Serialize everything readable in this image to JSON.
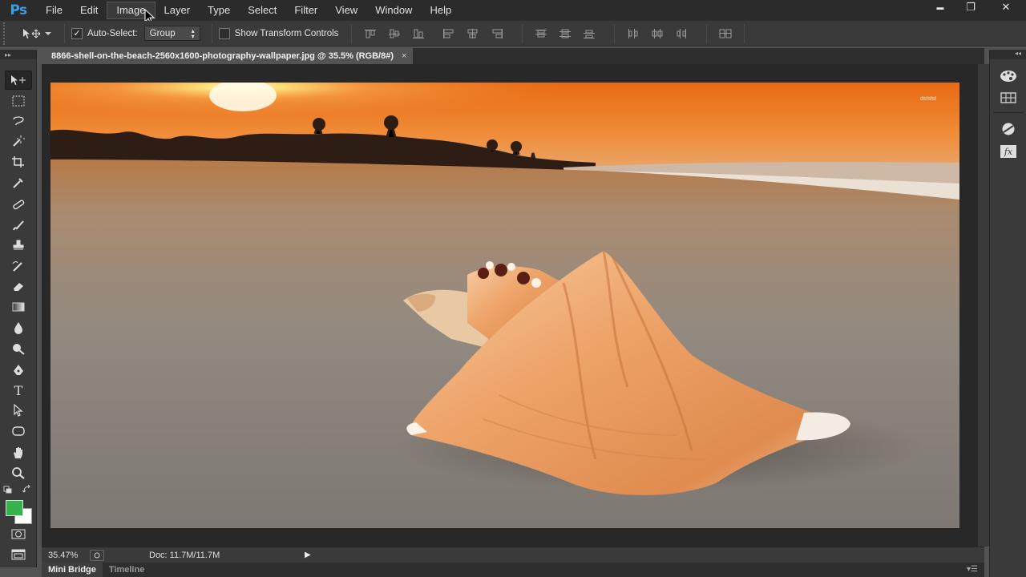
{
  "app": {
    "logo": "Ps"
  },
  "menu": {
    "items": [
      "File",
      "Edit",
      "Image",
      "Layer",
      "Type",
      "Select",
      "Filter",
      "View",
      "Window",
      "Help"
    ],
    "active_index": 2
  },
  "window_controls": {
    "minimize": "▬",
    "restore": "❐",
    "close": "✕"
  },
  "options_bar": {
    "auto_select_label": "Auto-Select:",
    "auto_select_checked": true,
    "auto_select_target": "Group",
    "show_transform_label": "Show Transform Controls",
    "show_transform_checked": false
  },
  "document": {
    "tab_title": "8866-shell-on-the-beach-2560x1600-photography-wallpaper.jpg @ 35.5% (RGB/8#)",
    "close_glyph": "×"
  },
  "image": {
    "watermark": "dsfsfsf",
    "colors": {
      "sky_top": "#e9711d",
      "sky_glow": "#ffd36a",
      "sand": "#8d8780",
      "shell": "#e9a06a"
    }
  },
  "status_bar": {
    "zoom": "35.47%",
    "doc_info": "Doc: 11.7M/11.7M",
    "arrow": "▶"
  },
  "bottom_panel": {
    "tabs": [
      "Mini Bridge",
      "Timeline"
    ],
    "active_index": 0,
    "menu_glyph": "▾☰"
  },
  "toolbar": {
    "collapse_glyph": "▸▸",
    "tools": [
      "move-tool",
      "marquee-tool",
      "lasso-tool",
      "magic-wand-tool",
      "crop-tool",
      "eyedropper-tool",
      "healing-brush-tool",
      "brush-tool",
      "clone-stamp-tool",
      "history-brush-tool",
      "eraser-tool",
      "gradient-tool",
      "blur-tool",
      "dodge-tool",
      "pen-tool",
      "type-tool",
      "path-selection-tool",
      "shape-tool",
      "hand-tool",
      "zoom-tool"
    ],
    "type_tool_glyph": "T",
    "foreground_color": "#36b24a",
    "background_color": "#ffffff"
  },
  "right_strip": {
    "collapse_glyph": "◂◂",
    "fx_glyph": "fx"
  }
}
